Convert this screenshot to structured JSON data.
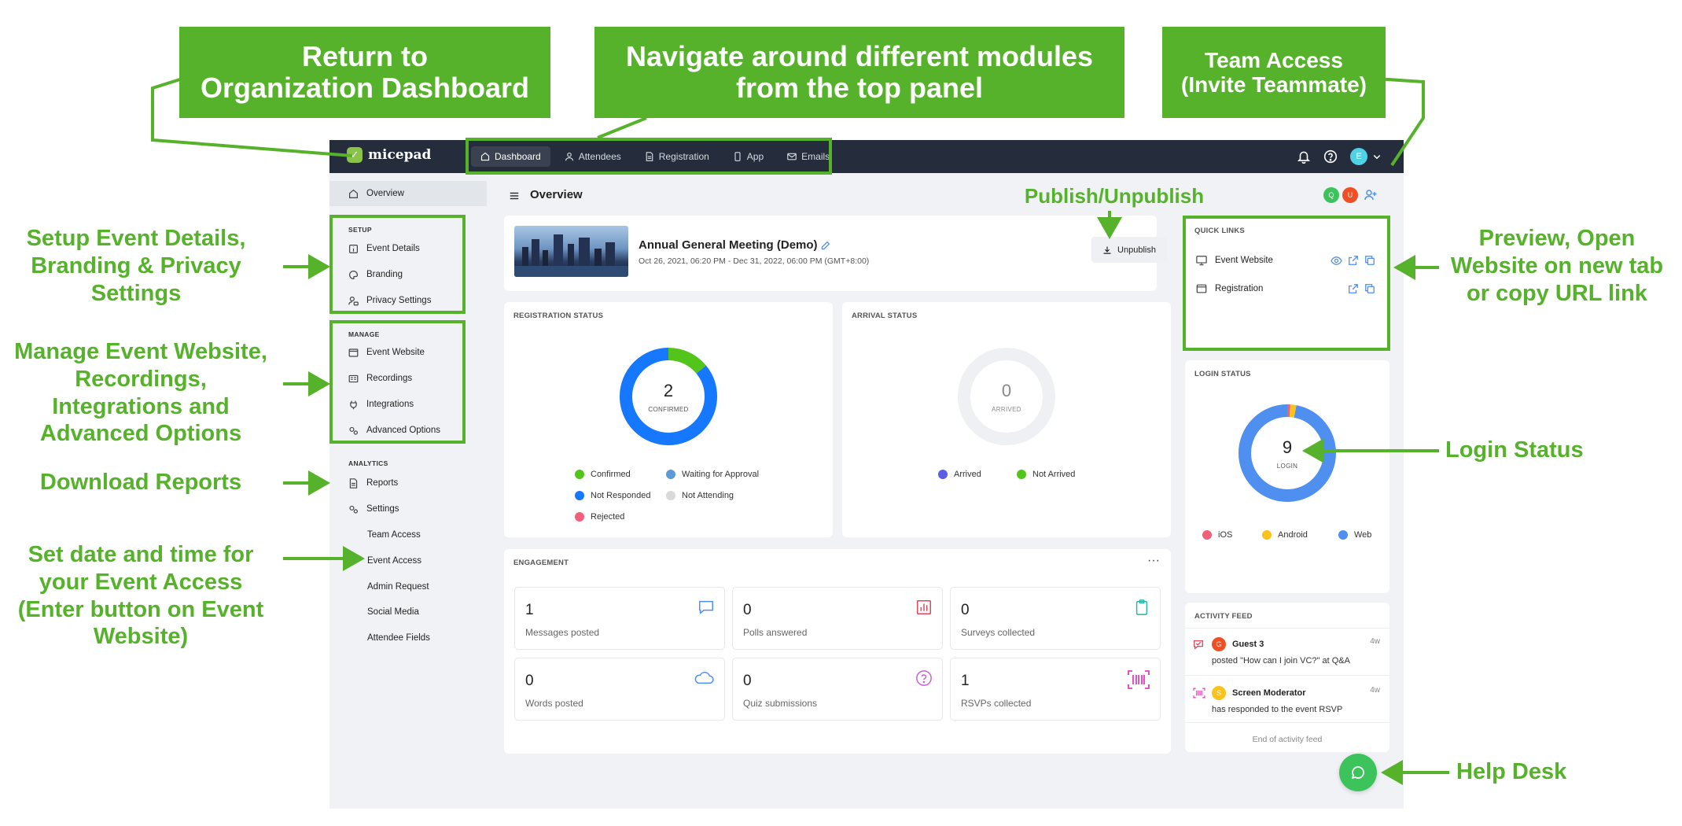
{
  "callouts": {
    "return_dashboard": "Return to\nOrganization Dashboard",
    "navigate": "Navigate around different modules\nfrom the top panel",
    "team_access": "Team Access\n(Invite Teammate)",
    "publish": "Publish/Unpublish",
    "setup": "Setup Event Details,\nBranding & Privacy\nSettings",
    "manage": "Manage Event Website,\nRecordings,\nIntegrations and\nAdvanced Options",
    "reports": "Download Reports",
    "event_access": "Set date and time for\nyour Event Access\n(Enter button on Event\nWebsite)",
    "preview": "Preview, Open\nWebsite on new tab\nor copy URL link",
    "login_status": "Login Status",
    "help_desk": "Help Desk"
  },
  "topbar": {
    "logo_text": "micepad",
    "nav": [
      "Dashboard",
      "Attendees",
      "Registration",
      "App",
      "Emails"
    ],
    "user_initial": "E"
  },
  "sidebar": {
    "overview": "Overview",
    "setup_label": "SETUP",
    "setup_items": [
      "Event Details",
      "Branding",
      "Privacy Settings"
    ],
    "manage_label": "MANAGE",
    "manage_items": [
      "Event Website",
      "Recordings",
      "Integrations",
      "Advanced Options"
    ],
    "analytics_label": "ANALYTICS",
    "reports": "Reports",
    "settings": "Settings",
    "settings_items": [
      "Team Access",
      "Event Access",
      "Admin Request",
      "Social Media",
      "Attendee Fields"
    ]
  },
  "header": {
    "title": "Overview",
    "team_avatars": [
      "Q",
      "U"
    ]
  },
  "event": {
    "name": "Annual General Meeting (Demo)",
    "dates": "Oct 26, 2021, 06:20 PM - Dec 31, 2022, 06:00 PM (GMT+8:00)",
    "unpublish": "Unpublish"
  },
  "registration_status": {
    "title": "REGISTRATION STATUS",
    "center_value": "2",
    "center_label": "CONFIRMED",
    "legend": [
      "Confirmed",
      "Waiting for Approval",
      "Not Responded",
      "Not Attending",
      "Rejected"
    ],
    "fractions": {
      "confirmed": 0.14,
      "not_responded": 0.86
    },
    "colors": {
      "confirmed": "#52c41a",
      "waiting": "#5b9bd5",
      "not_responded": "#1677ff",
      "not_attending": "#d9d9d9",
      "rejected": "#f0607a"
    }
  },
  "arrival_status": {
    "title": "ARRIVAL STATUS",
    "center_value": "0",
    "center_label": "ARRIVED",
    "legend": [
      "Arrived",
      "Not Arrived"
    ],
    "colors": {
      "arrived": "#5b5fe6",
      "not_arrived": "#52c41a"
    }
  },
  "quick_links": {
    "title": "QUICK LINKS",
    "items": [
      "Event Website",
      "Registration"
    ]
  },
  "login_status": {
    "title": "LOGIN STATUS",
    "center_value": "9",
    "center_label": "LOGIN",
    "legend": [
      "iOS",
      "Android",
      "Web"
    ],
    "fractions": {
      "ios": 0.01,
      "android": 0.02,
      "web": 0.97
    },
    "colors": {
      "ios": "#f0607a",
      "android": "#fac21a",
      "web": "#4f8ff0"
    }
  },
  "engagement": {
    "title": "ENGAGEMENT",
    "more": "···",
    "items": [
      {
        "value": "1",
        "label": "Messages posted"
      },
      {
        "value": "0",
        "label": "Polls answered"
      },
      {
        "value": "0",
        "label": "Surveys collected"
      },
      {
        "value": "0",
        "label": "Words posted"
      },
      {
        "value": "0",
        "label": "Quiz submissions"
      },
      {
        "value": "1",
        "label": "RSVPs collected"
      }
    ]
  },
  "activity_feed": {
    "title": "ACTIVITY FEED",
    "items": [
      {
        "initial": "G",
        "name": "Guest 3",
        "text": "posted \"How can I join VC?\" at Q&A",
        "time": "4w"
      },
      {
        "initial": "S",
        "name": "Screen Moderator",
        "text": "has responded to the event RSVP",
        "time": "4w"
      }
    ],
    "end": "End of activity feed"
  }
}
